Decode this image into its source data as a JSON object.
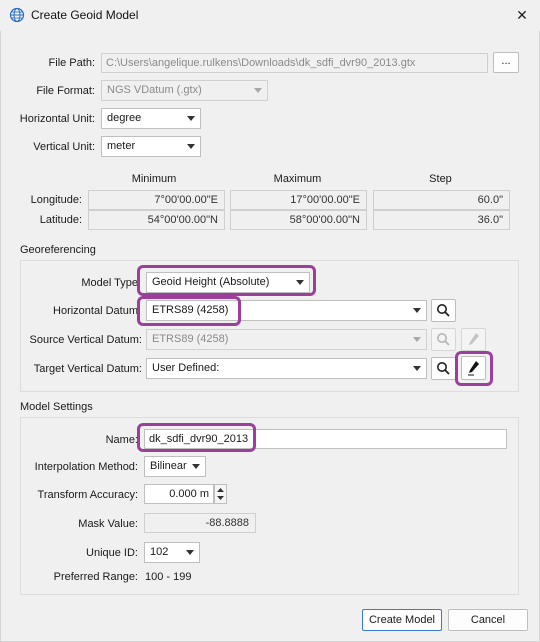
{
  "window": {
    "title": "Create Geoid Model",
    "close": "✕"
  },
  "file": {
    "path_label": "File Path:",
    "path_value": "C:\\Users\\angelique.rulkens\\Downloads\\dk_sdfi_dvr90_2013.gtx",
    "browse_label": "...",
    "format_label": "File Format:",
    "format_value": "NGS VDatum (.gtx)",
    "hunit_label": "Horizontal Unit:",
    "hunit_value": "degree",
    "vunit_label": "Vertical Unit:",
    "vunit_value": "meter"
  },
  "extent": {
    "headers": {
      "min": "Minimum",
      "max": "Maximum",
      "step": "Step"
    },
    "longitude": {
      "label": "Longitude:",
      "min": "7°00'00.00\"E",
      "max": "17°00'00.00\"E",
      "step": "60.0\""
    },
    "latitude": {
      "label": "Latitude:",
      "min": "54°00'00.00\"N",
      "max": "58°00'00.00\"N",
      "step": "36.0\""
    }
  },
  "georef": {
    "section": "Georeferencing",
    "model_type_label": "Model Type",
    "model_type_value": "Geoid Height (Absolute)",
    "hdatum_label": "Horizontal Datum",
    "hdatum_value": "ETRS89 (4258)",
    "svdatum_label": "Source Vertical Datum:",
    "svdatum_value": "ETRS89 (4258)",
    "tvdatum_label": "Target Vertical Datum:",
    "tvdatum_value": "User Defined:"
  },
  "model": {
    "section": "Model Settings",
    "name_label": "Name:",
    "name_value": "dk_sdfi_dvr90_2013",
    "interp_label": "Interpolation Method:",
    "interp_value": "Bilinear",
    "accuracy_label": "Transform Accuracy:",
    "accuracy_value": "0.000 m",
    "mask_label": "Mask Value:",
    "mask_value": "-88.8888",
    "uid_label": "Unique ID:",
    "uid_value": "102",
    "range_label": "Preferred Range:",
    "range_value": "100 - 199"
  },
  "buttons": {
    "create": "Create Model",
    "cancel": "Cancel"
  },
  "colors": {
    "highlight": "#9b3f9d",
    "background": "#f0f0f0"
  }
}
